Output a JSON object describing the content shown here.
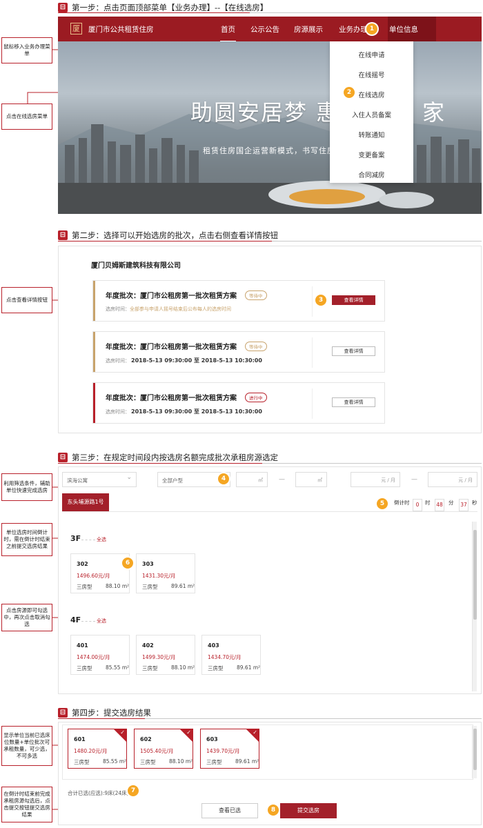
{
  "step1": {
    "title": "第一步：点击页面顶部菜单【业务办理】--【在线选房】"
  },
  "step2": {
    "title": "第二步：选择可以开始选房的批次，点击右侧查看详情按钮"
  },
  "step3": {
    "title": "第三步：在规定时间段内按选房名额完成批次承租房源选定"
  },
  "step4": {
    "title": "第四步：提交选房结果"
  },
  "annotations": {
    "a1": "鼠标移入业务办理菜单",
    "a2": "点击在线选房菜单",
    "a3": "点击查看详情按钮",
    "a4": "利用筛选条件，辅助单位快速完成选房",
    "a5": "单位选房时间倒计时，需在倒计时结束之前提交选房结果",
    "a6": "点击房源即可勾选中，再次点击取消勾选",
    "a7": "显示单位当前已选床位数量+单位批次可承租数量，可少选，不可多选",
    "a8": "在倒计时结束前完成承租房源勾选后，点击提交按钮提交选房结果"
  },
  "badges": [
    "1",
    "2",
    "3",
    "4",
    "5",
    "6",
    "7",
    "8"
  ],
  "nav": {
    "logo_glyph": "厦",
    "brand": "厦门市公共租赁住房",
    "items": [
      "首页",
      "公示公告",
      "房源展示",
      "业务办理",
      "单位信息"
    ]
  },
  "hero": {
    "title": "助圆安居梦 惠",
    "title_tail": "家",
    "subtitle": "租赁住房国企运营新模式，书写住房"
  },
  "dropdown": [
    "在线申请",
    "在线摇号",
    "在线选房",
    "入住人员备案",
    "转账通知",
    "变更备案",
    "合同减房"
  ],
  "company": "厦门贝姆斯建筑科技有限公司",
  "batches": [
    {
      "title": "年度批次：厦门市公租房第一批次租赁方案",
      "tag": "等待中",
      "time_label": "选房时间：",
      "time": "全部参与申请人摇号结束后公布每人的选房时间",
      "button": "查看详情",
      "color": "#c8a36c"
    },
    {
      "title": "年度批次：厦门市公租房第一批次租赁方案",
      "tag": "等待中",
      "time_label": "选房时间：",
      "time": "2018-5-13 09:30:00 至 2018-5-13 10:30:00",
      "button": "查看详情",
      "color": "#c8a36c"
    },
    {
      "title": "年度批次：厦门市公租房第一批次租赁方案",
      "tag": "进行中",
      "time_label": "选房时间：",
      "time": "2018-5-13 09:30:00 至 2018-5-13 10:30:00",
      "button": "查看详情",
      "color": "#b8202a"
    }
  ],
  "filters": {
    "community": "滨海公寓",
    "room_type": "全部户型",
    "area_unit": "㎡",
    "price_unit": "元 / 月",
    "range_sep": "—"
  },
  "building_tab": "东头埔源路1号",
  "countdown": {
    "label": "倒计时",
    "h_value": "0",
    "h_unit": "时",
    "m_value": "48",
    "m_unit": "分",
    "s_value": "37",
    "s_unit": "秒"
  },
  "floors": [
    {
      "name": "3F",
      "select_all": "全选",
      "rooms": [
        {
          "no": "302",
          "price": "1496.60元/月",
          "type": "三房型",
          "area": "88.10 m²"
        },
        {
          "no": "303",
          "price": "1431.30元/月",
          "type": "三房型",
          "area": "89.61 m²"
        }
      ]
    },
    {
      "name": "4F",
      "select_all": "全选",
      "rooms": [
        {
          "no": "401",
          "price": "1474.00元/月",
          "type": "三房型",
          "area": "85.55 m²"
        },
        {
          "no": "402",
          "price": "1499.30元/月",
          "type": "三房型",
          "area": "88.10 m²"
        },
        {
          "no": "403",
          "price": "1434.70元/月",
          "type": "三房型",
          "area": "89.61 m²"
        }
      ]
    }
  ],
  "selected_rooms": [
    {
      "no": "601",
      "price": "1480.20元/月",
      "type": "三房型",
      "area": "85.55 m²"
    },
    {
      "no": "602",
      "price": "1505.40元/月",
      "type": "三房型",
      "area": "88.10 m²"
    },
    {
      "no": "603",
      "price": "1439.70元/月",
      "type": "三房型",
      "area": "89.61 m²"
    }
  ],
  "total": "合计已选(应选):9床(24床)",
  "buttons": {
    "view": "查看已选",
    "submit": "提交选房"
  },
  "colors": {
    "brand": "#b8202a",
    "nav": "#9b1b22",
    "badge": "#f5a623",
    "tag_wait": "#c8a36c"
  }
}
